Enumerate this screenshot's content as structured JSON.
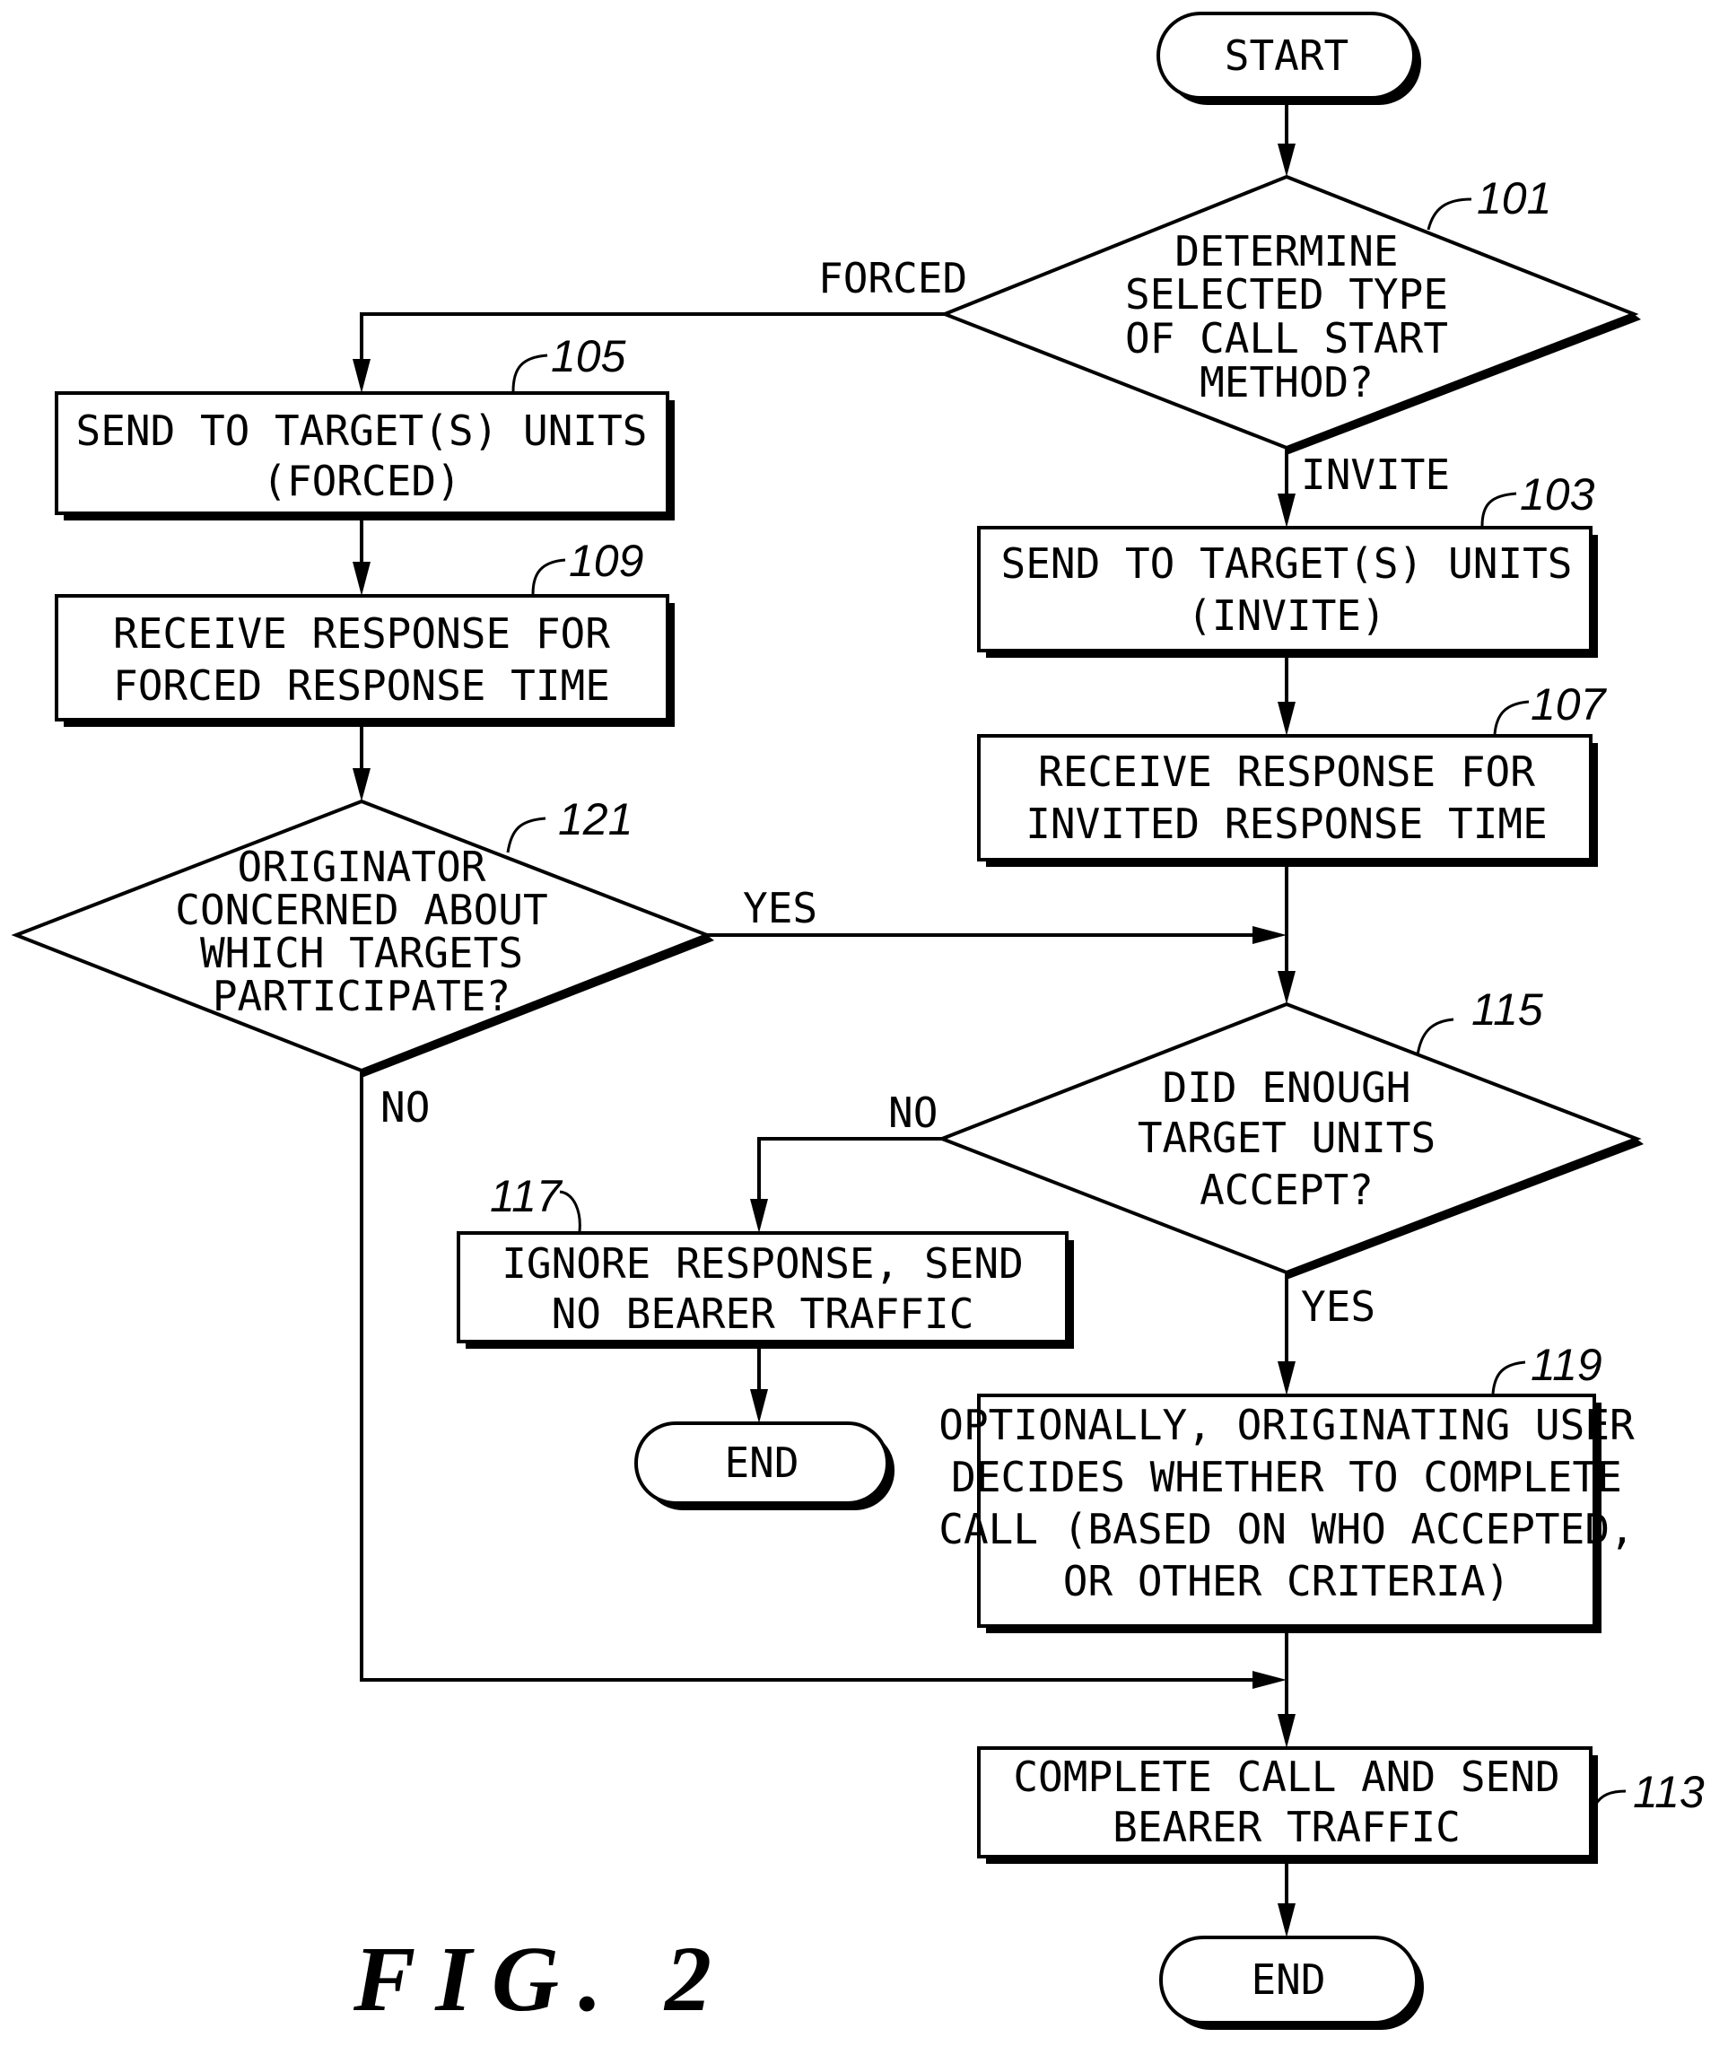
{
  "figure": {
    "caption": "FIG. 2"
  },
  "nodes": {
    "start": {
      "label": [
        "START"
      ]
    },
    "n101": {
      "ref": "101",
      "label": [
        "DETERMINE",
        "SELECTED TYPE",
        "OF CALL START",
        "METHOD?"
      ]
    },
    "n105": {
      "ref": "105",
      "label": [
        "SEND TO TARGET(S) UNITS",
        "(FORCED)"
      ]
    },
    "n109": {
      "ref": "109",
      "label": [
        "RECEIVE RESPONSE FOR",
        "FORCED RESPONSE TIME"
      ]
    },
    "n121": {
      "ref": "121",
      "label": [
        "ORIGINATOR",
        "CONCERNED ABOUT",
        "WHICH TARGETS",
        "PARTICIPATE?"
      ]
    },
    "n103": {
      "ref": "103",
      "label": [
        "SEND TO TARGET(S) UNITS",
        "(INVITE)"
      ]
    },
    "n107": {
      "ref": "107",
      "label": [
        "RECEIVE RESPONSE FOR",
        "INVITED RESPONSE TIME"
      ]
    },
    "n115": {
      "ref": "115",
      "label": [
        "DID ENOUGH",
        "TARGET UNITS",
        "ACCEPT?"
      ]
    },
    "n117": {
      "ref": "117",
      "label": [
        "IGNORE RESPONSE, SEND",
        "NO BEARER TRAFFIC"
      ]
    },
    "end_left": {
      "label": [
        "END"
      ]
    },
    "n119": {
      "ref": "119",
      "label": [
        "OPTIONALLY, ORIGINATING USER",
        "DECIDES WHETHER TO COMPLETE",
        "CALL (BASED ON WHO ACCEPTED,",
        "OR OTHER CRITERIA)"
      ]
    },
    "n113": {
      "ref": "113",
      "label": [
        "COMPLETE CALL AND SEND",
        "BEARER TRAFFIC"
      ]
    },
    "end_bottom": {
      "label": [
        "END"
      ]
    }
  },
  "edges": {
    "forced": "FORCED",
    "invite": "INVITE",
    "yes_121": "YES",
    "no_121": "NO",
    "no_115": "NO",
    "yes_115": "YES"
  }
}
